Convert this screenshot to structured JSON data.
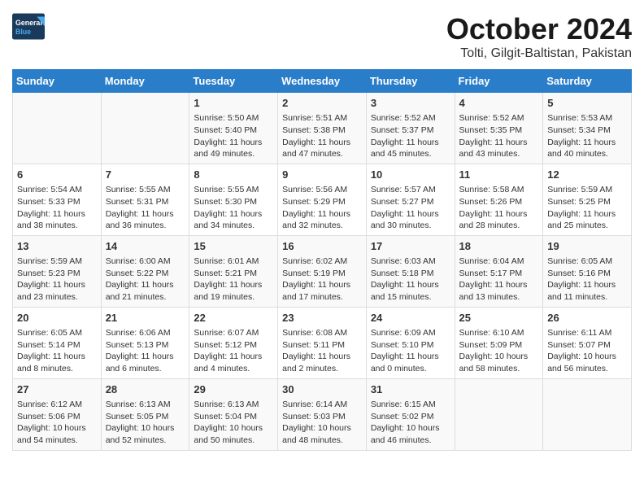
{
  "header": {
    "logo": {
      "line1": "General",
      "line2": "Blue"
    },
    "title": "October 2024",
    "location": "Tolti, Gilgit-Baltistan, Pakistan"
  },
  "days_of_week": [
    "Sunday",
    "Monday",
    "Tuesday",
    "Wednesday",
    "Thursday",
    "Friday",
    "Saturday"
  ],
  "weeks": [
    [
      {
        "day": "",
        "content": ""
      },
      {
        "day": "",
        "content": ""
      },
      {
        "day": "1",
        "content": "Sunrise: 5:50 AM\nSunset: 5:40 PM\nDaylight: 11 hours and 49 minutes."
      },
      {
        "day": "2",
        "content": "Sunrise: 5:51 AM\nSunset: 5:38 PM\nDaylight: 11 hours and 47 minutes."
      },
      {
        "day": "3",
        "content": "Sunrise: 5:52 AM\nSunset: 5:37 PM\nDaylight: 11 hours and 45 minutes."
      },
      {
        "day": "4",
        "content": "Sunrise: 5:52 AM\nSunset: 5:35 PM\nDaylight: 11 hours and 43 minutes."
      },
      {
        "day": "5",
        "content": "Sunrise: 5:53 AM\nSunset: 5:34 PM\nDaylight: 11 hours and 40 minutes."
      }
    ],
    [
      {
        "day": "6",
        "content": "Sunrise: 5:54 AM\nSunset: 5:33 PM\nDaylight: 11 hours and 38 minutes."
      },
      {
        "day": "7",
        "content": "Sunrise: 5:55 AM\nSunset: 5:31 PM\nDaylight: 11 hours and 36 minutes."
      },
      {
        "day": "8",
        "content": "Sunrise: 5:55 AM\nSunset: 5:30 PM\nDaylight: 11 hours and 34 minutes."
      },
      {
        "day": "9",
        "content": "Sunrise: 5:56 AM\nSunset: 5:29 PM\nDaylight: 11 hours and 32 minutes."
      },
      {
        "day": "10",
        "content": "Sunrise: 5:57 AM\nSunset: 5:27 PM\nDaylight: 11 hours and 30 minutes."
      },
      {
        "day": "11",
        "content": "Sunrise: 5:58 AM\nSunset: 5:26 PM\nDaylight: 11 hours and 28 minutes."
      },
      {
        "day": "12",
        "content": "Sunrise: 5:59 AM\nSunset: 5:25 PM\nDaylight: 11 hours and 25 minutes."
      }
    ],
    [
      {
        "day": "13",
        "content": "Sunrise: 5:59 AM\nSunset: 5:23 PM\nDaylight: 11 hours and 23 minutes."
      },
      {
        "day": "14",
        "content": "Sunrise: 6:00 AM\nSunset: 5:22 PM\nDaylight: 11 hours and 21 minutes."
      },
      {
        "day": "15",
        "content": "Sunrise: 6:01 AM\nSunset: 5:21 PM\nDaylight: 11 hours and 19 minutes."
      },
      {
        "day": "16",
        "content": "Sunrise: 6:02 AM\nSunset: 5:19 PM\nDaylight: 11 hours and 17 minutes."
      },
      {
        "day": "17",
        "content": "Sunrise: 6:03 AM\nSunset: 5:18 PM\nDaylight: 11 hours and 15 minutes."
      },
      {
        "day": "18",
        "content": "Sunrise: 6:04 AM\nSunset: 5:17 PM\nDaylight: 11 hours and 13 minutes."
      },
      {
        "day": "19",
        "content": "Sunrise: 6:05 AM\nSunset: 5:16 PM\nDaylight: 11 hours and 11 minutes."
      }
    ],
    [
      {
        "day": "20",
        "content": "Sunrise: 6:05 AM\nSunset: 5:14 PM\nDaylight: 11 hours and 8 minutes."
      },
      {
        "day": "21",
        "content": "Sunrise: 6:06 AM\nSunset: 5:13 PM\nDaylight: 11 hours and 6 minutes."
      },
      {
        "day": "22",
        "content": "Sunrise: 6:07 AM\nSunset: 5:12 PM\nDaylight: 11 hours and 4 minutes."
      },
      {
        "day": "23",
        "content": "Sunrise: 6:08 AM\nSunset: 5:11 PM\nDaylight: 11 hours and 2 minutes."
      },
      {
        "day": "24",
        "content": "Sunrise: 6:09 AM\nSunset: 5:10 PM\nDaylight: 11 hours and 0 minutes."
      },
      {
        "day": "25",
        "content": "Sunrise: 6:10 AM\nSunset: 5:09 PM\nDaylight: 10 hours and 58 minutes."
      },
      {
        "day": "26",
        "content": "Sunrise: 6:11 AM\nSunset: 5:07 PM\nDaylight: 10 hours and 56 minutes."
      }
    ],
    [
      {
        "day": "27",
        "content": "Sunrise: 6:12 AM\nSunset: 5:06 PM\nDaylight: 10 hours and 54 minutes."
      },
      {
        "day": "28",
        "content": "Sunrise: 6:13 AM\nSunset: 5:05 PM\nDaylight: 10 hours and 52 minutes."
      },
      {
        "day": "29",
        "content": "Sunrise: 6:13 AM\nSunset: 5:04 PM\nDaylight: 10 hours and 50 minutes."
      },
      {
        "day": "30",
        "content": "Sunrise: 6:14 AM\nSunset: 5:03 PM\nDaylight: 10 hours and 48 minutes."
      },
      {
        "day": "31",
        "content": "Sunrise: 6:15 AM\nSunset: 5:02 PM\nDaylight: 10 hours and 46 minutes."
      },
      {
        "day": "",
        "content": ""
      },
      {
        "day": "",
        "content": ""
      }
    ]
  ]
}
